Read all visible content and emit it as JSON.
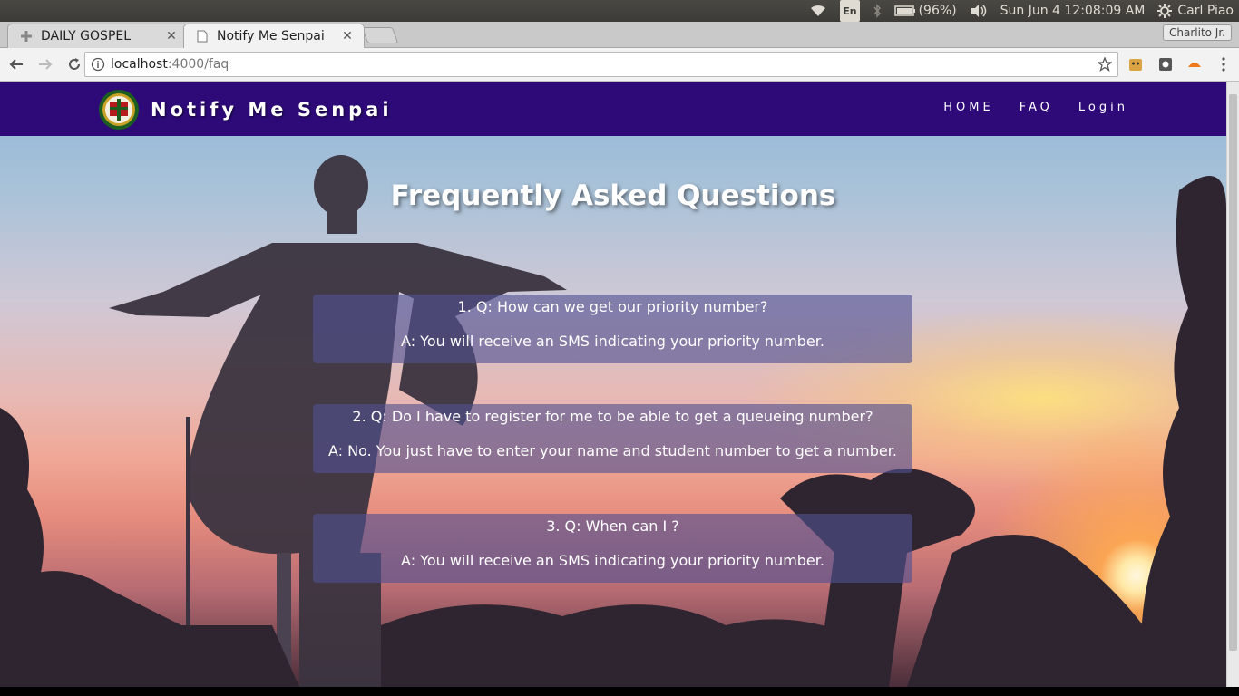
{
  "os": {
    "language": "En",
    "battery": "(96%)",
    "clock": "Sun Jun  4 12:08:09 AM",
    "user": "Carl Piao"
  },
  "browser": {
    "tabs": [
      {
        "title": "DAILY GOSPEL",
        "active": false
      },
      {
        "title": "Notify Me Senpai",
        "active": true
      }
    ],
    "profile_name": "Charlito Jr.",
    "url_host": "localhost",
    "url_path": ":4000/faq"
  },
  "site": {
    "brand": "Notify Me Senpai",
    "nav": [
      "HOME",
      "FAQ",
      "Login"
    ]
  },
  "faq": {
    "title": "Frequently Asked Questions",
    "items": [
      {
        "q": "1. Q: How can we get our priority number?",
        "a": "A: You will receive an SMS indicating your priority number."
      },
      {
        "q": "2. Q: Do I have to register for me to be able to get a queueing number?",
        "a": "A: No. You just have to enter your name and student number to get a number."
      },
      {
        "q": "3. Q: When can I ?",
        "a": "A: You will receive an SMS indicating your priority number."
      }
    ]
  },
  "colors": {
    "navbar": "#2d0a78",
    "card": "rgba(80,80,145,0.62)"
  }
}
